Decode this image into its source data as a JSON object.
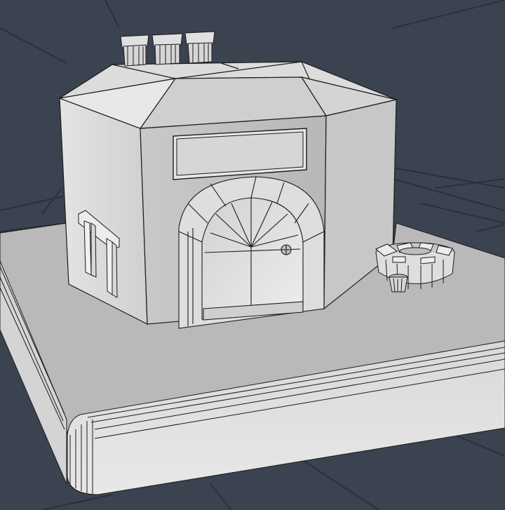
{
  "viewport": {
    "background_color": "#3b4350",
    "grid_color": "#2b313b",
    "model_face_light": "#e2e2e2",
    "model_face_mid": "#cdcdcd",
    "model_face_dark": "#b3b3b3",
    "wire_color": "#1c1c1c"
  }
}
